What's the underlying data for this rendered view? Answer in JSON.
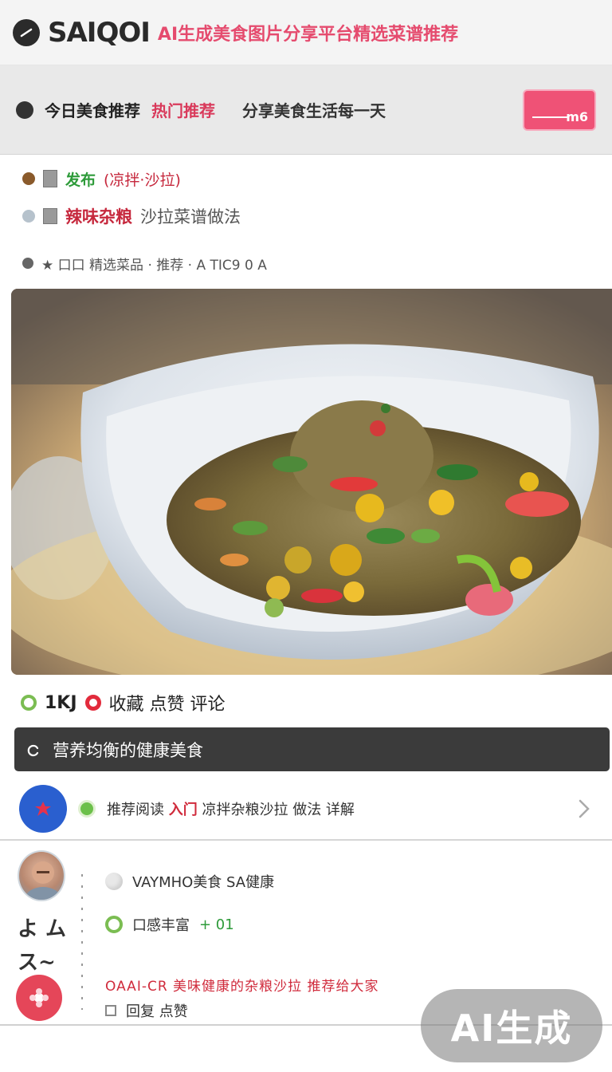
{
  "header": {
    "title": "SAIQOI",
    "subtitle": "AI生成美食图片分享平台精选菜谱推荐"
  },
  "subheader": {
    "text_a": "今日美食推荐",
    "text_b": "热门推荐",
    "text_c": "分享美食生活每一天",
    "button_label": "m6"
  },
  "meta": {
    "row1_green": "发布",
    "row1_red": "(凉拌·沙拉)",
    "row2_red": "辣味杂粮",
    "row2_gray": "沙拉菜谱做法",
    "row3": "★ 口口 精选菜品 · 推荐 · A TIC9 0 A"
  },
  "rating": {
    "count": "1KJ",
    "label": "收藏 点赞 评论"
  },
  "dark_bar": {
    "text": "营养均衡的健康美食"
  },
  "list_item": {
    "text_prefix": "推荐阅读",
    "text_red": "入门",
    "text_suffix": "凉拌杂粮沙拉 做法 详解"
  },
  "comments": {
    "handwrite_1": "よ ム",
    "handwrite_2": "ス~",
    "line1": "VAYMHO美食 SA健康",
    "line2_prefix": "口感丰富",
    "line2_green": "+ 01",
    "line3_red": "OAAI-CR 美味健康的杂粮沙拉 推荐给大家",
    "line4": "回复 点赞"
  },
  "watermark": {
    "label": "AI生成"
  },
  "colors": {
    "accent_pink": "#ef5276",
    "accent_red": "#d02b3c",
    "accent_green": "#2e9b3a",
    "dark_bar": "#3b3b3b",
    "avatar_blue": "#2a5fcf"
  },
  "icons": {
    "logo": "circle-logo-icon",
    "chevron": "chevron-right-icon",
    "reply": "reply-icon"
  }
}
